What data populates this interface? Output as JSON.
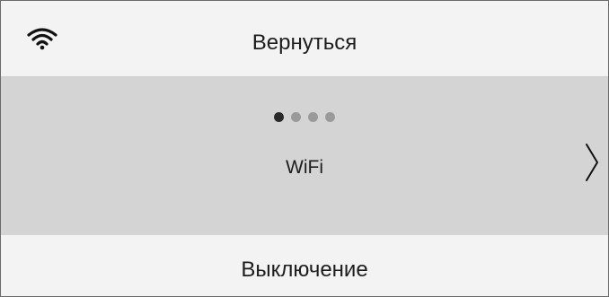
{
  "header": {
    "status_icon": "wifi-icon",
    "back_label": "Вернуться"
  },
  "carousel": {
    "page_count": 4,
    "active_page": 1,
    "current_label": "WiFi",
    "next_icon": "chevron-right-icon"
  },
  "footer": {
    "shutdown_label": "Выключение"
  },
  "colors": {
    "background": "#f3f3f3",
    "carousel_background": "#d4d4d4",
    "text": "#1d1d1d",
    "dot_active": "#2a2a2a",
    "dot_inactive": "#9a9a9a"
  }
}
